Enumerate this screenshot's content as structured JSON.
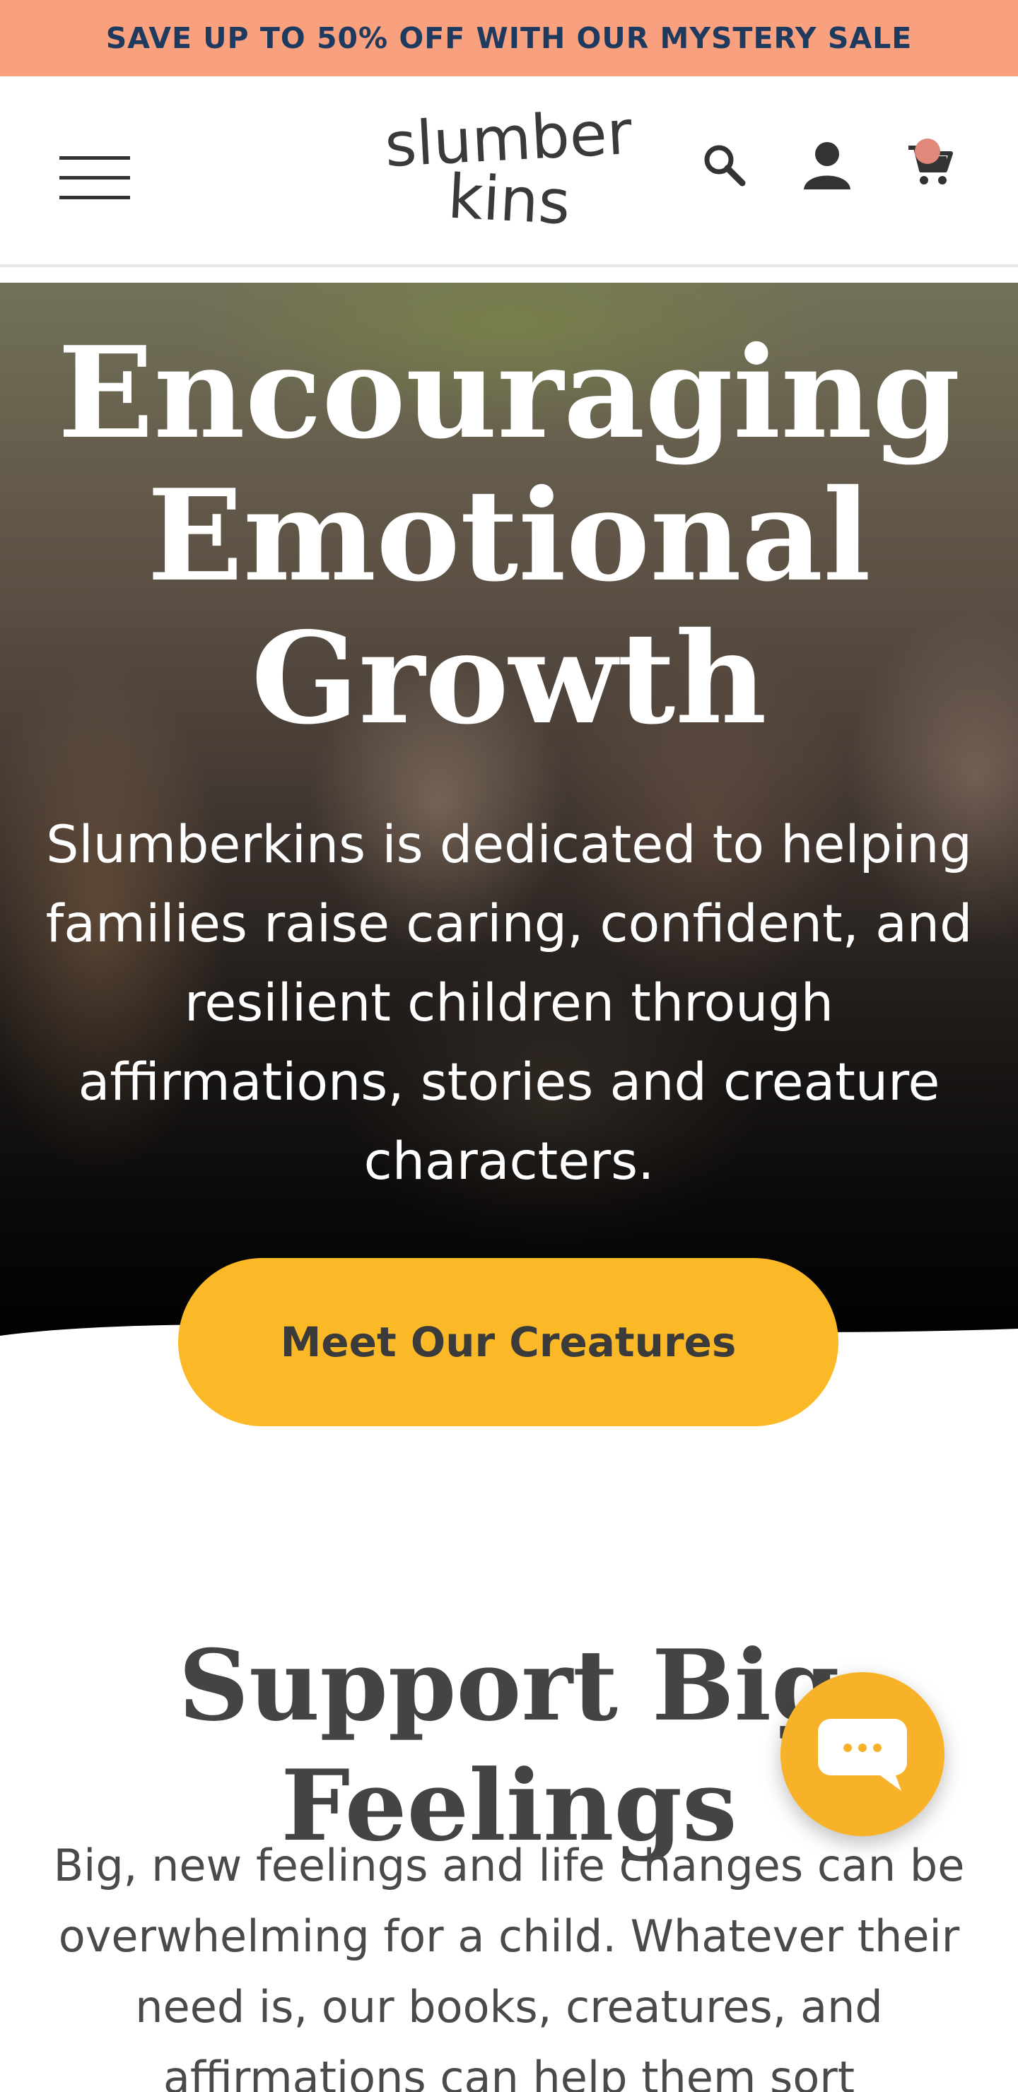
{
  "announcement": {
    "text": "SAVE UP TO 50% OFF WITH OUR MYSTERY SALE"
  },
  "header": {
    "logo": {
      "line1": "slumber",
      "line2": "kins"
    },
    "icons": {
      "menu": "hamburger-menu-icon",
      "search": "search-icon",
      "account": "account-icon",
      "cart": "cart-icon"
    }
  },
  "hero": {
    "title_lines": [
      "Encouraging",
      "Emotional",
      "Growth"
    ],
    "body": "Slumberkins is dedicated to helping families raise caring, confident, and resilient children through affirmations, stories and creature characters.",
    "cta_label": "Meet Our Creatures"
  },
  "section": {
    "title": "Support Big Feelings",
    "body": "Big, new feelings and life changes can be overwhelming for a child. Whatever their need is, our books, creatures, and affirmations can help them sort"
  },
  "chat": {
    "icon": "chat-bubble-icon"
  },
  "colors": {
    "announcement_bg": "#f9a07e",
    "announcement_text": "#1f3a5f",
    "cta_bg": "#fbb827",
    "chat_bg": "#f7b22a",
    "cart_badge": "#e0897a"
  }
}
